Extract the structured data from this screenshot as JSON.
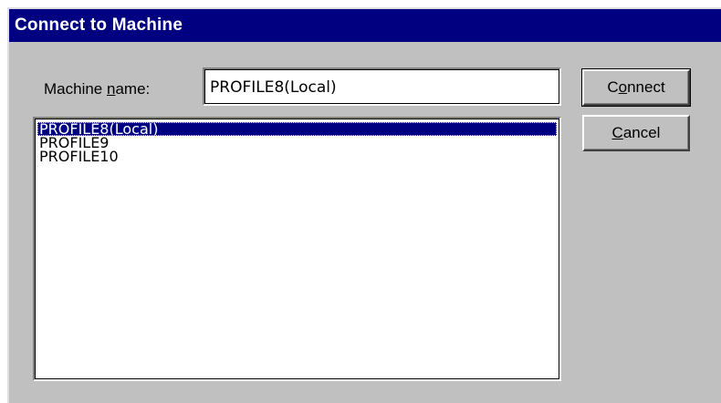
{
  "window": {
    "title": "Connect to Machine"
  },
  "form": {
    "machine_name_label_pre": "Machine ",
    "machine_name_label_mnemonic": "n",
    "machine_name_label_post": "ame:",
    "machine_name_value": "PROFILE8(Local)"
  },
  "machine_list": {
    "items": [
      {
        "label": "PROFILE8(Local)",
        "selected": true
      },
      {
        "label": "PROFILE9",
        "selected": false
      },
      {
        "label": "PROFILE10",
        "selected": false
      }
    ]
  },
  "buttons": {
    "connect_pre": "C",
    "connect_mnemonic": "o",
    "connect_post": "nnect",
    "cancel_mnemonic": "C",
    "cancel_post": "ancel"
  },
  "colors": {
    "titlebar": "#000080",
    "face": "#c0c0c0",
    "selection": "#000080"
  }
}
